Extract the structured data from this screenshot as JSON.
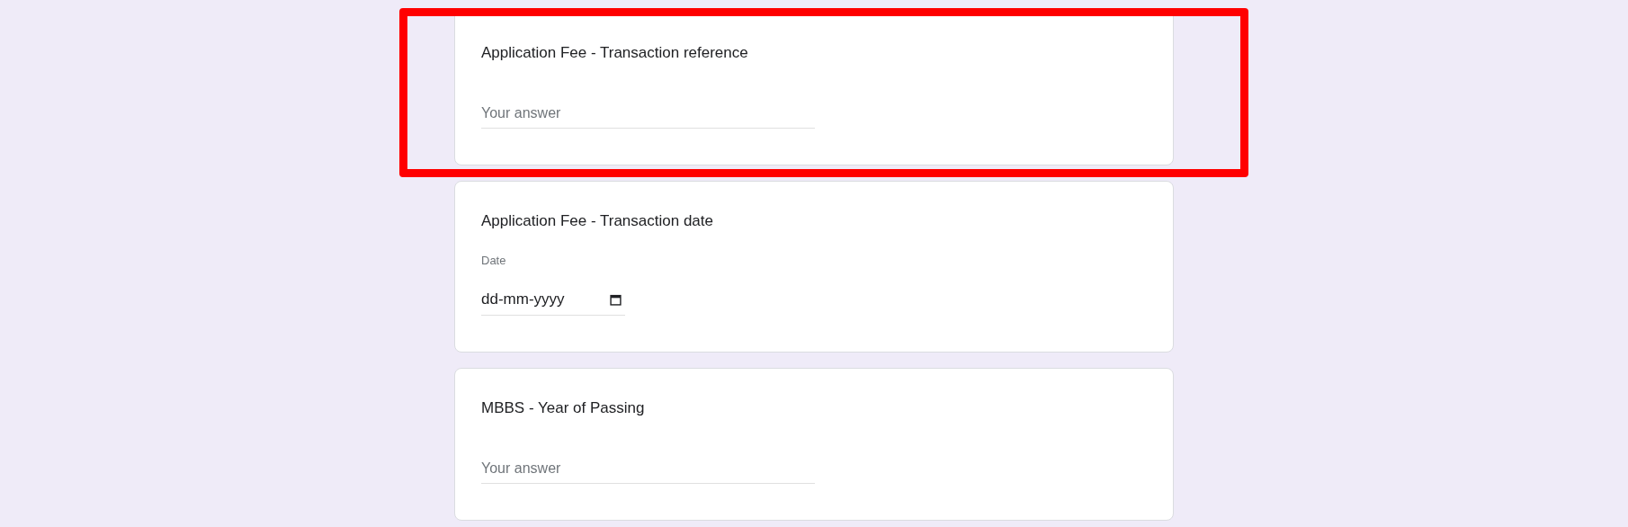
{
  "questions": [
    {
      "kind": "text",
      "title": "Application Fee - Transaction reference",
      "placeholder": "Your answer",
      "highlighted": true
    },
    {
      "kind": "date",
      "title": "Application Fee - Transaction date",
      "field_label": "Date",
      "placeholder": "dd-mm-yyyy",
      "highlighted": false
    },
    {
      "kind": "text",
      "title": "MBBS - Year of Passing",
      "placeholder": "Your answer",
      "highlighted": false
    }
  ]
}
